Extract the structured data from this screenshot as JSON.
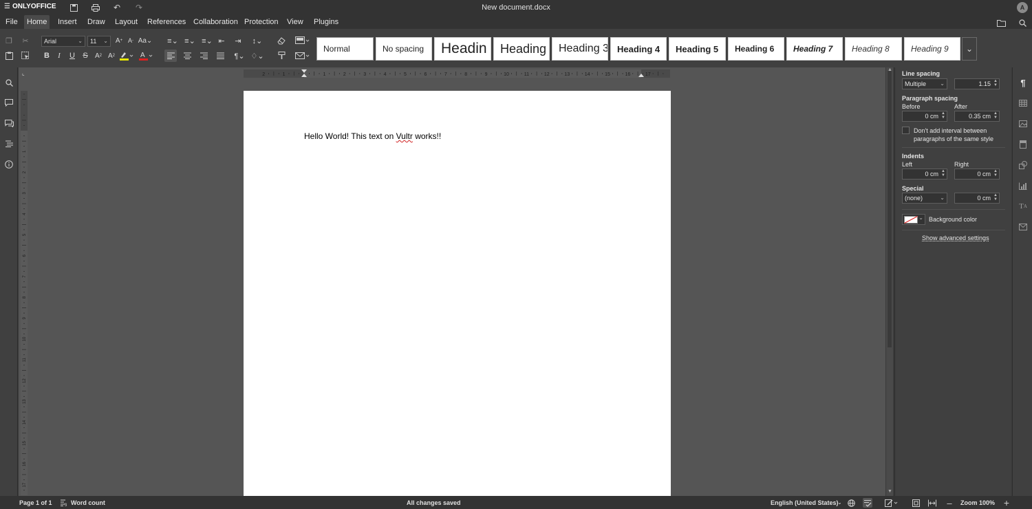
{
  "app": {
    "brand": "ONLYOFFICE",
    "document_title": "New document.docx",
    "user_initial": "A"
  },
  "menu": {
    "items": [
      "File",
      "Home",
      "Insert",
      "Draw",
      "Layout",
      "References",
      "Collaboration",
      "Protection",
      "View",
      "Plugins"
    ],
    "active": "Home"
  },
  "toolbar": {
    "font_name": "Arial",
    "font_size": "11",
    "styles": [
      {
        "label": "Normal"
      },
      {
        "label": "No spacing"
      },
      {
        "label": "Headin"
      },
      {
        "label": "Heading"
      },
      {
        "label": "Heading 3"
      },
      {
        "label": "Heading 4"
      },
      {
        "label": "Heading 5"
      },
      {
        "label": "Heading 6"
      },
      {
        "label": "Heading 7"
      },
      {
        "label": "Heading 8"
      },
      {
        "label": "Heading 9"
      }
    ]
  },
  "document": {
    "text_before": "Hello World! This text on ",
    "misspelled": "Vultr",
    "text_after": " works!!"
  },
  "ruler": {
    "h_numbers": [
      "2",
      "1",
      "1",
      "2",
      "3",
      "4",
      "5",
      "6",
      "7",
      "8",
      "9",
      "10",
      "11",
      "12",
      "13",
      "14",
      "15",
      "16",
      "17"
    ],
    "v_numbers": [
      "1",
      "2",
      "3",
      "4",
      "5",
      "6",
      "7",
      "8",
      "9",
      "10",
      "11",
      "12",
      "13",
      "14",
      "15",
      "16",
      "17",
      "18",
      "19"
    ]
  },
  "paragraph_settings": {
    "line_spacing_label": "Line spacing",
    "line_spacing_type": "Multiple",
    "line_spacing_value": "1.15",
    "paragraph_spacing_label": "Paragraph spacing",
    "before_label": "Before",
    "before_value": "0 cm",
    "after_label": "After",
    "after_value": "0.35 cm",
    "no_interval_label_1": "Don't add interval between",
    "no_interval_label_2": "paragraphs of the same style",
    "indents_label": "Indents",
    "left_label": "Left",
    "left_value": "0 cm",
    "right_label": "Right",
    "right_value": "0 cm",
    "special_label": "Special",
    "special_type": "(none)",
    "special_value": "0 cm",
    "background_color_label": "Background color",
    "advanced_link": "Show advanced settings"
  },
  "statusbar": {
    "page_info": "Page 1 of 1",
    "word_count": "Word count",
    "save_status": "All changes saved",
    "language": "English (United States)",
    "zoom": "Zoom 100%"
  },
  "colors": {
    "chrome_dark": "#333333",
    "toolbar": "#404040",
    "canvas": "#555555",
    "page": "#ffffff",
    "spell_error": "#d02020"
  }
}
